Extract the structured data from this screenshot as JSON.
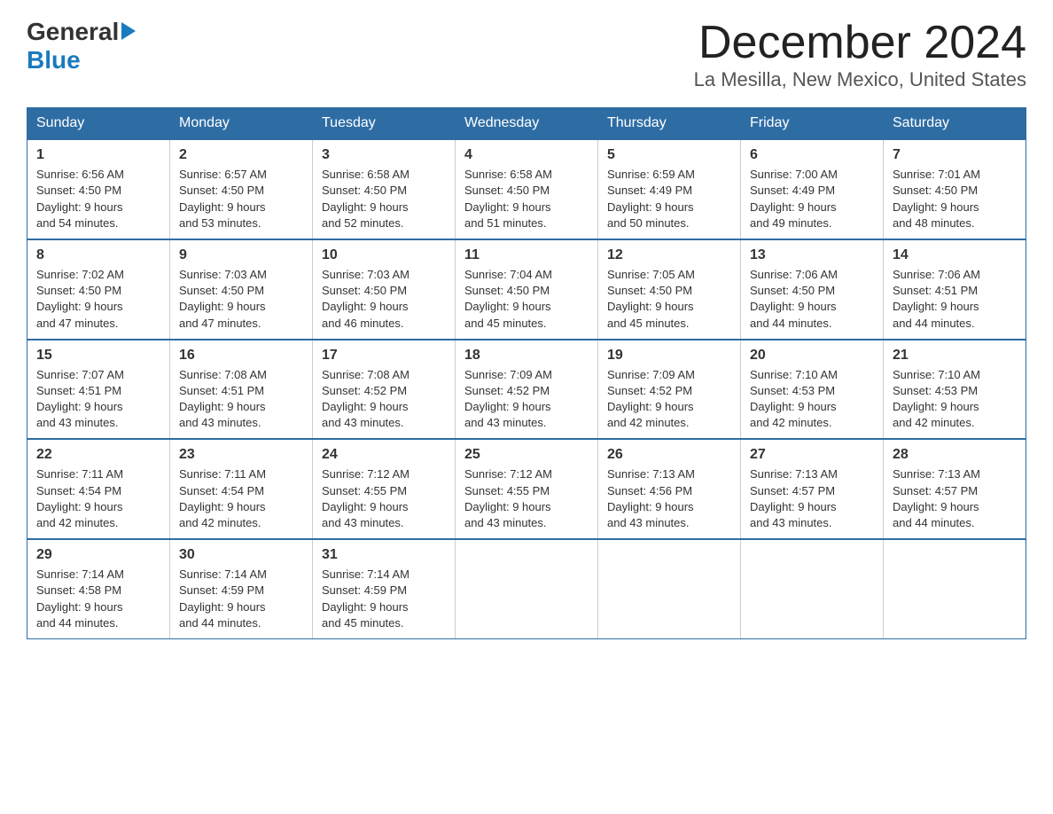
{
  "header": {
    "logo_general": "General",
    "logo_blue": "Blue",
    "title": "December 2024",
    "subtitle": "La Mesilla, New Mexico, United States"
  },
  "days_of_week": [
    "Sunday",
    "Monday",
    "Tuesday",
    "Wednesday",
    "Thursday",
    "Friday",
    "Saturday"
  ],
  "weeks": [
    [
      {
        "num": "1",
        "sunrise": "6:56 AM",
        "sunset": "4:50 PM",
        "daylight": "9 hours and 54 minutes."
      },
      {
        "num": "2",
        "sunrise": "6:57 AM",
        "sunset": "4:50 PM",
        "daylight": "9 hours and 53 minutes."
      },
      {
        "num": "3",
        "sunrise": "6:58 AM",
        "sunset": "4:50 PM",
        "daylight": "9 hours and 52 minutes."
      },
      {
        "num": "4",
        "sunrise": "6:58 AM",
        "sunset": "4:50 PM",
        "daylight": "9 hours and 51 minutes."
      },
      {
        "num": "5",
        "sunrise": "6:59 AM",
        "sunset": "4:49 PM",
        "daylight": "9 hours and 50 minutes."
      },
      {
        "num": "6",
        "sunrise": "7:00 AM",
        "sunset": "4:49 PM",
        "daylight": "9 hours and 49 minutes."
      },
      {
        "num": "7",
        "sunrise": "7:01 AM",
        "sunset": "4:50 PM",
        "daylight": "9 hours and 48 minutes."
      }
    ],
    [
      {
        "num": "8",
        "sunrise": "7:02 AM",
        "sunset": "4:50 PM",
        "daylight": "9 hours and 47 minutes."
      },
      {
        "num": "9",
        "sunrise": "7:03 AM",
        "sunset": "4:50 PM",
        "daylight": "9 hours and 47 minutes."
      },
      {
        "num": "10",
        "sunrise": "7:03 AM",
        "sunset": "4:50 PM",
        "daylight": "9 hours and 46 minutes."
      },
      {
        "num": "11",
        "sunrise": "7:04 AM",
        "sunset": "4:50 PM",
        "daylight": "9 hours and 45 minutes."
      },
      {
        "num": "12",
        "sunrise": "7:05 AM",
        "sunset": "4:50 PM",
        "daylight": "9 hours and 45 minutes."
      },
      {
        "num": "13",
        "sunrise": "7:06 AM",
        "sunset": "4:50 PM",
        "daylight": "9 hours and 44 minutes."
      },
      {
        "num": "14",
        "sunrise": "7:06 AM",
        "sunset": "4:51 PM",
        "daylight": "9 hours and 44 minutes."
      }
    ],
    [
      {
        "num": "15",
        "sunrise": "7:07 AM",
        "sunset": "4:51 PM",
        "daylight": "9 hours and 43 minutes."
      },
      {
        "num": "16",
        "sunrise": "7:08 AM",
        "sunset": "4:51 PM",
        "daylight": "9 hours and 43 minutes."
      },
      {
        "num": "17",
        "sunrise": "7:08 AM",
        "sunset": "4:52 PM",
        "daylight": "9 hours and 43 minutes."
      },
      {
        "num": "18",
        "sunrise": "7:09 AM",
        "sunset": "4:52 PM",
        "daylight": "9 hours and 43 minutes."
      },
      {
        "num": "19",
        "sunrise": "7:09 AM",
        "sunset": "4:52 PM",
        "daylight": "9 hours and 42 minutes."
      },
      {
        "num": "20",
        "sunrise": "7:10 AM",
        "sunset": "4:53 PM",
        "daylight": "9 hours and 42 minutes."
      },
      {
        "num": "21",
        "sunrise": "7:10 AM",
        "sunset": "4:53 PM",
        "daylight": "9 hours and 42 minutes."
      }
    ],
    [
      {
        "num": "22",
        "sunrise": "7:11 AM",
        "sunset": "4:54 PM",
        "daylight": "9 hours and 42 minutes."
      },
      {
        "num": "23",
        "sunrise": "7:11 AM",
        "sunset": "4:54 PM",
        "daylight": "9 hours and 42 minutes."
      },
      {
        "num": "24",
        "sunrise": "7:12 AM",
        "sunset": "4:55 PM",
        "daylight": "9 hours and 43 minutes."
      },
      {
        "num": "25",
        "sunrise": "7:12 AM",
        "sunset": "4:55 PM",
        "daylight": "9 hours and 43 minutes."
      },
      {
        "num": "26",
        "sunrise": "7:13 AM",
        "sunset": "4:56 PM",
        "daylight": "9 hours and 43 minutes."
      },
      {
        "num": "27",
        "sunrise": "7:13 AM",
        "sunset": "4:57 PM",
        "daylight": "9 hours and 43 minutes."
      },
      {
        "num": "28",
        "sunrise": "7:13 AM",
        "sunset": "4:57 PM",
        "daylight": "9 hours and 44 minutes."
      }
    ],
    [
      {
        "num": "29",
        "sunrise": "7:14 AM",
        "sunset": "4:58 PM",
        "daylight": "9 hours and 44 minutes."
      },
      {
        "num": "30",
        "sunrise": "7:14 AM",
        "sunset": "4:59 PM",
        "daylight": "9 hours and 44 minutes."
      },
      {
        "num": "31",
        "sunrise": "7:14 AM",
        "sunset": "4:59 PM",
        "daylight": "9 hours and 45 minutes."
      },
      null,
      null,
      null,
      null
    ]
  ],
  "labels": {
    "sunrise": "Sunrise:",
    "sunset": "Sunset:",
    "daylight": "Daylight:"
  }
}
